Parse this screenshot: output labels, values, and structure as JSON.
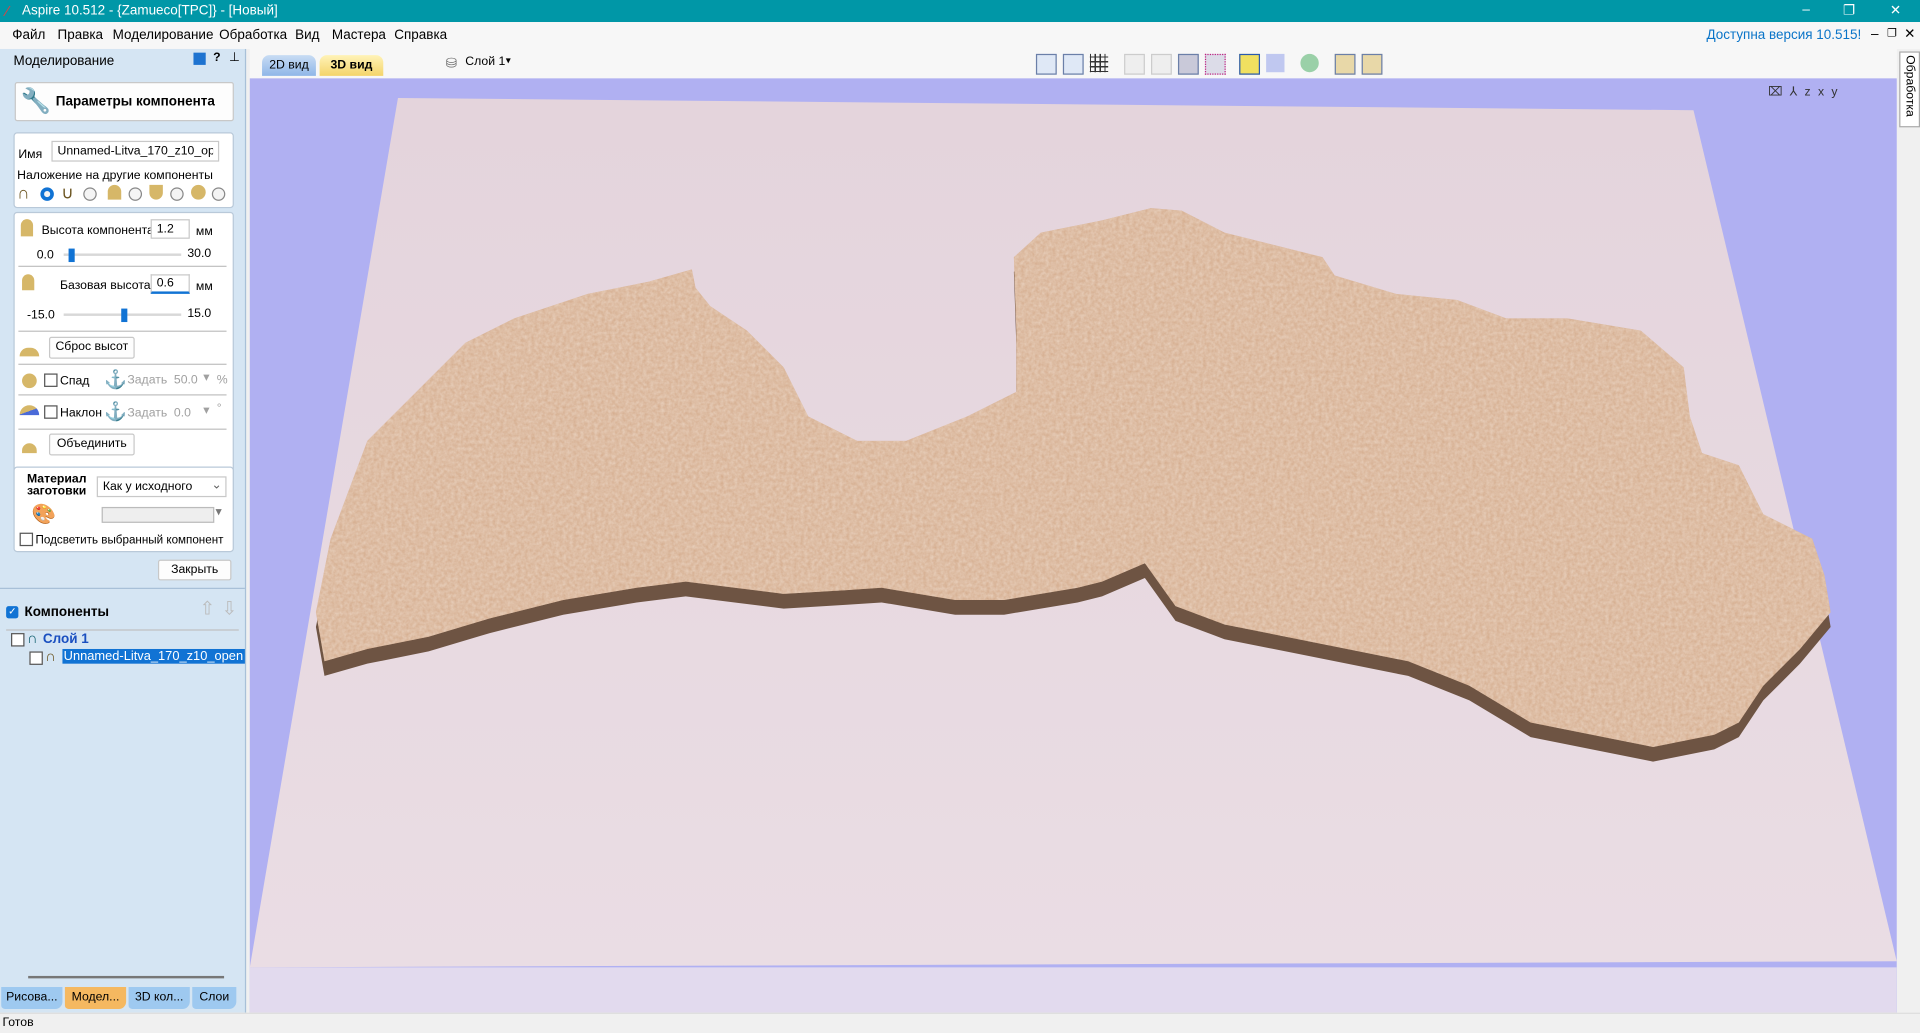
{
  "window": {
    "title": "Aspire 10.512 - {Zamueco[TPC]} - [Новый]"
  },
  "menu": [
    "Файл",
    "Правка",
    "Моделирование",
    "Обработка",
    "Вид",
    "Мастера",
    "Справка"
  ],
  "update_notice": "Доступна версия 10.515!",
  "panel": {
    "header": "Моделирование",
    "help": "?",
    "title_button": "Параметры компонента",
    "name_label": "Имя",
    "name_value": "Unnamed-Litva_170_z10_open",
    "overlay_label": "Наложение на другие компоненты",
    "overlay_selected": 0,
    "height_label": "Высота компонента:",
    "height_value": "1.2",
    "unit": "мм",
    "height_min": "0.0",
    "height_max": "30.0",
    "height_fraction": 0.04,
    "base_label": "Базовая высота:",
    "base_value": "0.6",
    "base_min": "-15.0",
    "base_max": "15.0",
    "base_fraction": 0.52,
    "reset_button": "Сброс высот",
    "fade_label": "Спад",
    "fade_set": "Задать",
    "fade_value": "50.0",
    "fade_unit": "%",
    "tilt_label": "Наклон",
    "tilt_set": "Задать",
    "tilt_value": "0.0",
    "tilt_unit": "°",
    "merge_button": "Объединить",
    "material_label_1": "Материал",
    "material_label_2": "заготовки",
    "material_value": "Как у исходного",
    "highlight_label": "Подсветить выбранный компонент",
    "close_button": "Закрыть",
    "components_title": "Компоненты",
    "tree": {
      "layer": "Слой 1",
      "item": "Unnamed-Litva_170_z10_open"
    }
  },
  "bottom_tabs": [
    "Рисова...",
    "Модел...",
    "3D кол...",
    "Слои"
  ],
  "view_tabs": [
    "2D вид",
    "3D вид"
  ],
  "layer_dropdown": "Слой 1",
  "right_tab": "Обработка",
  "status": "Готов",
  "colors": {
    "title": "#0097a7",
    "sky": "#b0b0f2",
    "plane": "#e6d8e0",
    "relief": "#d2a888",
    "relief_side": "#6e5443"
  }
}
